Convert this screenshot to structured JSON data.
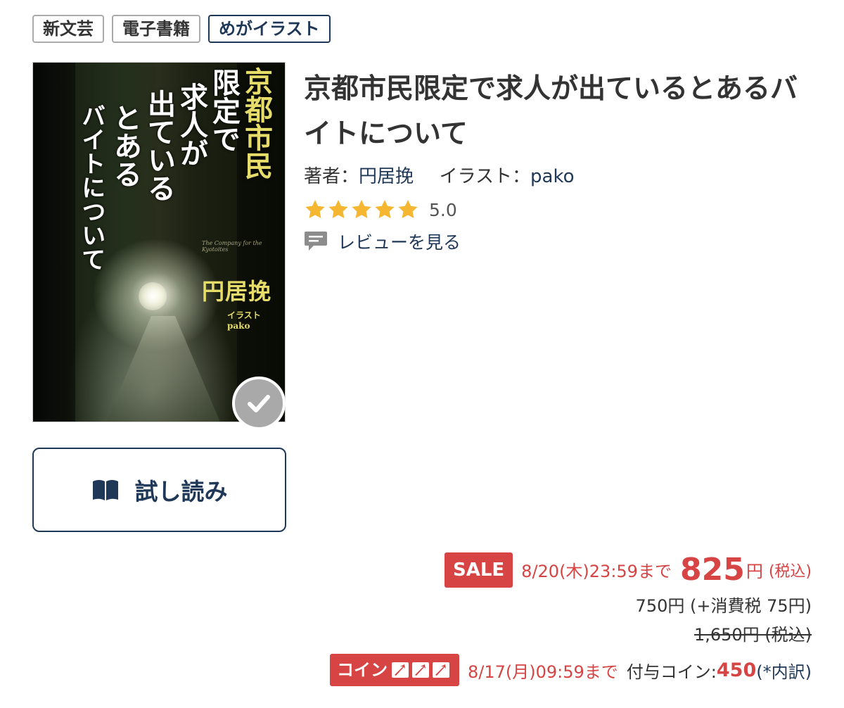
{
  "tags": [
    "新文芸",
    "電子書籍",
    "めがイラスト"
  ],
  "cover": {
    "title_columns": [
      "京都市民",
      "限定で",
      "求人が",
      "出ている",
      "とある",
      "バイトについて"
    ],
    "author": "円居挽",
    "illustrator_credit": "イラスト pako",
    "english_subtitle": "The Company for the Kyotoites"
  },
  "trial_button": {
    "label": "試し読み",
    "icon": "open-book-icon"
  },
  "book": {
    "title": "京都市民限定で求人が出ているとあるバイトについて",
    "author_label": "著者：",
    "author_name": "円居挽",
    "illustrator_label": "イラスト：",
    "illustrator_name": "pako",
    "rating": 5.0,
    "rating_text": "5.0",
    "review_link": "レビューを見る",
    "review_icon": "speech-bubble-icon"
  },
  "pricing": {
    "sale_badge": "SALE",
    "sale_until": "8/20(木)23:59まで",
    "sale_price": "825",
    "yen": "円",
    "tax_included": "(税込)",
    "breakdown": "750円 (+消費税 75円)",
    "original_price": "1,650円 (税込)",
    "coin_badge": "コイン",
    "coin_until": "8/17(月)09:59まで",
    "coin_label": "付与コイン:",
    "coin_value": "450",
    "coin_breakdown_link": "(*内訳)"
  },
  "colors": {
    "accent": "#1f3858",
    "sale_red": "#d64444",
    "star": "#f5b731",
    "check_badge": "#a9a9a9"
  }
}
